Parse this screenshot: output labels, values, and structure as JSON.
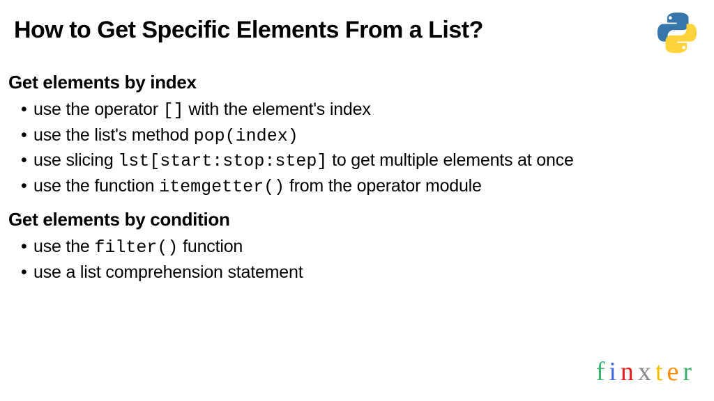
{
  "title": "How to Get Specific Elements From a List?",
  "sections": [
    {
      "heading": "Get elements by index",
      "items": [
        {
          "pre": "use the operator ",
          "code": "[]",
          "post": " with the element's index"
        },
        {
          "pre": "use the list's method ",
          "code": "pop(index)",
          "post": ""
        },
        {
          "pre": "use slicing ",
          "code": "lst[start:stop:step]",
          "post": " to get multiple elements at once"
        },
        {
          "pre": "use the function ",
          "code": "itemgetter()",
          "post": " from the operator module"
        }
      ]
    },
    {
      "heading": "Get elements by condition",
      "items": [
        {
          "pre": "use the ",
          "code": "filter()",
          "post": " function"
        },
        {
          "pre": "use a list comprehension statement",
          "code": "",
          "post": ""
        }
      ]
    }
  ],
  "brand": {
    "letters": [
      "f",
      "i",
      "n",
      "x",
      "t",
      "e",
      "r"
    ]
  }
}
